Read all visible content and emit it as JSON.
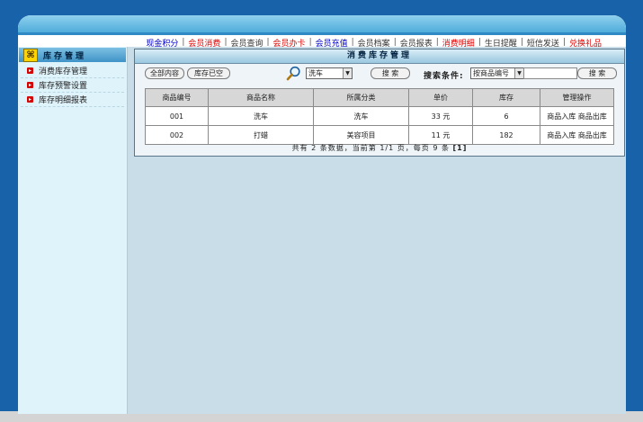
{
  "colors": {
    "nav_blue": "#0000cc",
    "nav_red": "#e00000",
    "nav_gray": "#333333"
  },
  "nav": [
    {
      "label": "现金积分",
      "color": "blue"
    },
    {
      "label": "会员消费",
      "color": "red"
    },
    {
      "label": "会员查询",
      "color": "gray"
    },
    {
      "label": "会员办卡",
      "color": "red"
    },
    {
      "label": "会员充值",
      "color": "blue"
    },
    {
      "label": "会员档案",
      "color": "gray"
    },
    {
      "label": "会员报表",
      "color": "gray"
    },
    {
      "label": "消费明细",
      "color": "red"
    },
    {
      "label": "生日提醒",
      "color": "gray"
    },
    {
      "label": "短信发送",
      "color": "gray"
    },
    {
      "label": "兑换礼品",
      "color": "red"
    }
  ],
  "sidebar": {
    "title": "库存管理",
    "title_icon": "⌘",
    "items": [
      {
        "label": "消费库存管理"
      },
      {
        "label": "库存预警设置"
      },
      {
        "label": "库存明细报表"
      }
    ]
  },
  "panel": {
    "title": "消费库存管理",
    "btn_all": "全部内容",
    "btn_empty": "库存已空",
    "category_value": "洗车",
    "search_btn": "搜 索",
    "search_label": "搜索条件:",
    "condition_value": "按商品编号",
    "search_input_value": "",
    "search_btn2": "搜 索"
  },
  "table": {
    "headers": [
      "商品编号",
      "商品名称",
      "所属分类",
      "单价",
      "库存",
      "管理操作"
    ],
    "rows": [
      {
        "id": "001",
        "name": "洗车",
        "category": "洗车",
        "price": "33 元",
        "stock": "6",
        "op_in": "商品入库",
        "op_out": "商品出库"
      },
      {
        "id": "002",
        "name": "打蜡",
        "category": "美容项目",
        "price": "11 元",
        "stock": "182",
        "op_in": "商品入库",
        "op_out": "商品出库"
      }
    ]
  },
  "pagination": {
    "prefix": "共有",
    "count": "2",
    "mid1": "条数据，当前第",
    "page": "1/1",
    "mid2": "页，每页",
    "per_page": "9",
    "suffix": "条",
    "page_link": "[1]"
  }
}
